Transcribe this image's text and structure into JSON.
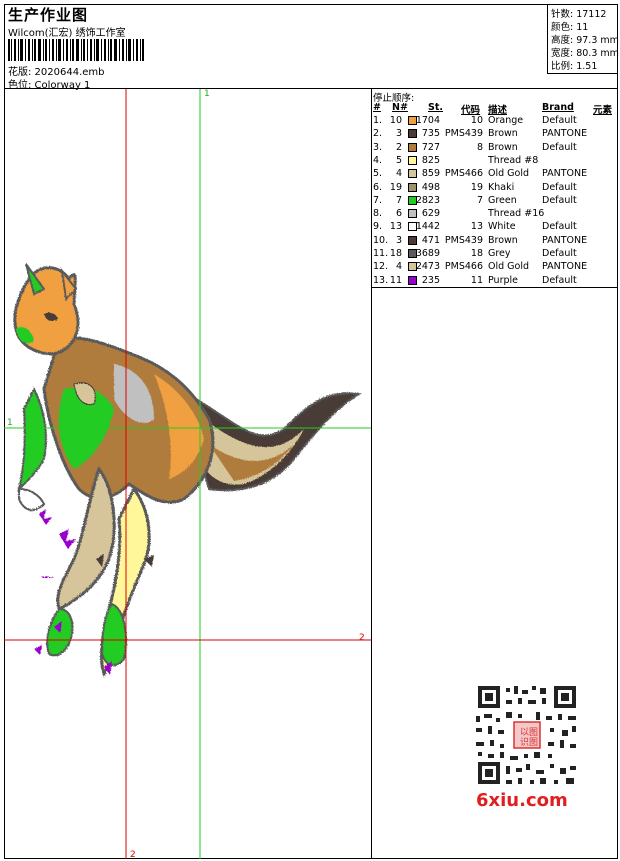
{
  "header": {
    "title": "生产作业图",
    "company": "Wilcom(汇宏) 绣饰工作室",
    "design_label": "花版: 2020644.emb",
    "colorway_label": "色位: Colorway 1"
  },
  "stats": {
    "stitches": "针数: 17112",
    "colors": "颜色: 11",
    "height": "高度: 97.3 mm",
    "width": "宽度: 80.3 mm",
    "scale": "比例: 1.51"
  },
  "guides": {
    "v_green_top": "1",
    "h_green_left": "1",
    "h_red_right": "2",
    "v_red_bottom": "2"
  },
  "stop_table": {
    "label": "停止顺序:",
    "headers": {
      "index": "#",
      "needle": "N#",
      "stitches": "St.",
      "code": "代码",
      "desc": "描述",
      "brand": "Brand",
      "element": "元素"
    },
    "rows": [
      {
        "idx": "1.",
        "n": "10",
        "color": "#f0a040",
        "st": "1704",
        "code": "10",
        "desc": "Orange",
        "brand": "Default"
      },
      {
        "idx": "2.",
        "n": "3",
        "color": "#4a3a36",
        "st": "735",
        "code": "PMS439",
        "desc": "Brown",
        "brand": "PANTONE"
      },
      {
        "idx": "3.",
        "n": "2",
        "color": "#b07c3c",
        "st": "727",
        "code": "8",
        "desc": "Brown",
        "brand": "Default"
      },
      {
        "idx": "4.",
        "n": "5",
        "color": "#fff79a",
        "st": "825",
        "code": "",
        "desc": "Thread #8",
        "brand": ""
      },
      {
        "idx": "5.",
        "n": "4",
        "color": "#d6c49a",
        "st": "859",
        "code": "PMS466",
        "desc": "Old Gold",
        "brand": "PANTONE"
      },
      {
        "idx": "6.",
        "n": "19",
        "color": "#9c9468",
        "st": "498",
        "code": "19",
        "desc": "Khaki",
        "brand": "Default"
      },
      {
        "idx": "7.",
        "n": "7",
        "color": "#22cc22",
        "st": "2823",
        "code": "7",
        "desc": "Green",
        "brand": "Default"
      },
      {
        "idx": "8.",
        "n": "6",
        "color": "#c0c0c0",
        "st": "629",
        "code": "",
        "desc": "Thread #16",
        "brand": ""
      },
      {
        "idx": "9.",
        "n": "13",
        "color": "#ffffff",
        "st": "1442",
        "code": "13",
        "desc": "White",
        "brand": "Default"
      },
      {
        "idx": "10.",
        "n": "3",
        "color": "#4a3a36",
        "st": "471",
        "code": "PMS439",
        "desc": "Brown",
        "brand": "PANTONE"
      },
      {
        "idx": "11.",
        "n": "18",
        "color": "#5a5a5a",
        "st": "3689",
        "code": "18",
        "desc": "Grey",
        "brand": "Default"
      },
      {
        "idx": "12.",
        "n": "4",
        "color": "#d6c49a",
        "st": "2473",
        "code": "PMS466",
        "desc": "Old Gold",
        "brand": "PANTONE"
      },
      {
        "idx": "13.",
        "n": "11",
        "color": "#9900cc",
        "st": "235",
        "code": "11",
        "desc": "Purple",
        "brand": "Default"
      }
    ]
  },
  "watermark": {
    "site": "6xiu.com",
    "qr_stamp": "以图识图"
  }
}
